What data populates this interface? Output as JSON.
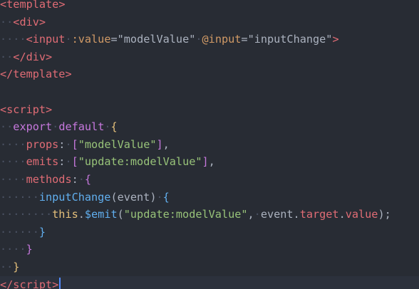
{
  "code": {
    "lines": [
      [
        {
          "t": "<",
          "c": "k-tag"
        },
        {
          "t": "template",
          "c": "k-tag"
        },
        {
          "t": ">",
          "c": "k-tag"
        }
      ],
      [
        {
          "t": "··",
          "c": "k-ws"
        },
        {
          "t": "<",
          "c": "k-tag"
        },
        {
          "t": "div",
          "c": "k-tag"
        },
        {
          "t": ">",
          "c": "k-tag"
        }
      ],
      [
        {
          "t": "····",
          "c": "k-ws"
        },
        {
          "t": "<",
          "c": "k-tag"
        },
        {
          "t": "input",
          "c": "k-tag"
        },
        {
          "t": "·",
          "c": "k-ws"
        },
        {
          "t": ":value",
          "c": "k-attr"
        },
        {
          "t": "=",
          "c": "k-punct"
        },
        {
          "t": "\"modelValue\"",
          "c": "k-punct"
        },
        {
          "t": "·",
          "c": "k-ws"
        },
        {
          "t": "@input",
          "c": "k-attr"
        },
        {
          "t": "=",
          "c": "k-punct"
        },
        {
          "t": "\"inputChange\"",
          "c": "k-punct"
        },
        {
          "t": ">",
          "c": "k-tag"
        }
      ],
      [
        {
          "t": "··",
          "c": "k-ws"
        },
        {
          "t": "</",
          "c": "k-tag"
        },
        {
          "t": "div",
          "c": "k-tag"
        },
        {
          "t": ">",
          "c": "k-tag"
        }
      ],
      [
        {
          "t": "</",
          "c": "k-tag"
        },
        {
          "t": "template",
          "c": "k-tag"
        },
        {
          "t": ">",
          "c": "k-tag"
        }
      ],
      [],
      [
        {
          "t": "<",
          "c": "k-tag"
        },
        {
          "t": "script",
          "c": "k-tag"
        },
        {
          "t": ">",
          "c": "k-tag"
        }
      ],
      [
        {
          "t": "··",
          "c": "k-ws"
        },
        {
          "t": "export",
          "c": "k-key"
        },
        {
          "t": "·",
          "c": "k-ws"
        },
        {
          "t": "default",
          "c": "k-key"
        },
        {
          "t": "·",
          "c": "k-ws"
        },
        {
          "t": "{",
          "c": "k-brace1"
        }
      ],
      [
        {
          "t": "····",
          "c": "k-ws"
        },
        {
          "t": "props",
          "c": "k-prop"
        },
        {
          "t": ":",
          "c": "k-punct"
        },
        {
          "t": "·",
          "c": "k-ws"
        },
        {
          "t": "[",
          "c": "k-brace2"
        },
        {
          "t": "\"modelValue\"",
          "c": "k-str"
        },
        {
          "t": "]",
          "c": "k-brace2"
        },
        {
          "t": ",",
          "c": "k-punct"
        }
      ],
      [
        {
          "t": "····",
          "c": "k-ws"
        },
        {
          "t": "emits",
          "c": "k-prop"
        },
        {
          "t": ":",
          "c": "k-punct"
        },
        {
          "t": "·",
          "c": "k-ws"
        },
        {
          "t": "[",
          "c": "k-brace2"
        },
        {
          "t": "\"update:modelValue\"",
          "c": "k-str"
        },
        {
          "t": "]",
          "c": "k-brace2"
        },
        {
          "t": ",",
          "c": "k-punct"
        }
      ],
      [
        {
          "t": "····",
          "c": "k-ws"
        },
        {
          "t": "methods",
          "c": "k-prop"
        },
        {
          "t": ":",
          "c": "k-punct"
        },
        {
          "t": "·",
          "c": "k-ws"
        },
        {
          "t": "{",
          "c": "k-brace2"
        }
      ],
      [
        {
          "t": "······",
          "c": "k-ws"
        },
        {
          "t": "inputChange",
          "c": "k-fn"
        },
        {
          "t": "(event)",
          "c": "k-punct"
        },
        {
          "t": "·",
          "c": "k-ws"
        },
        {
          "t": "{",
          "c": "k-brace3"
        }
      ],
      [
        {
          "t": "········",
          "c": "k-ws"
        },
        {
          "t": "this",
          "c": "k-this"
        },
        {
          "t": ".",
          "c": "k-punct"
        },
        {
          "t": "$emit",
          "c": "k-fn"
        },
        {
          "t": "(",
          "c": "k-punct"
        },
        {
          "t": "\"update:modelValue\"",
          "c": "k-str"
        },
        {
          "t": ",",
          "c": "k-punct"
        },
        {
          "t": "·",
          "c": "k-ws"
        },
        {
          "t": "event",
          "c": "k-punct"
        },
        {
          "t": ".",
          "c": "k-punct"
        },
        {
          "t": "target",
          "c": "k-prop"
        },
        {
          "t": ".",
          "c": "k-punct"
        },
        {
          "t": "value",
          "c": "k-prop"
        },
        {
          "t": ");",
          "c": "k-punct"
        }
      ],
      [
        {
          "t": "······",
          "c": "k-ws"
        },
        {
          "t": "}",
          "c": "k-brace3"
        }
      ],
      [
        {
          "t": "····",
          "c": "k-ws"
        },
        {
          "t": "}",
          "c": "k-brace2"
        }
      ],
      [
        {
          "t": "··",
          "c": "k-ws"
        },
        {
          "t": "}",
          "c": "k-brace1"
        }
      ],
      [
        {
          "t": "</",
          "c": "k-tag"
        },
        {
          "t": "script",
          "c": "k-tag"
        },
        {
          "t": ">",
          "c": "k-tag"
        }
      ]
    ],
    "current_line": 16,
    "colors": {
      "background": "#282c34",
      "current_line": "#2c313c",
      "tag": "#e06c75",
      "attribute": "#d19a66",
      "string": "#98c379",
      "keyword": "#c678dd",
      "function": "#61afef",
      "cursor": "#528bff"
    }
  }
}
